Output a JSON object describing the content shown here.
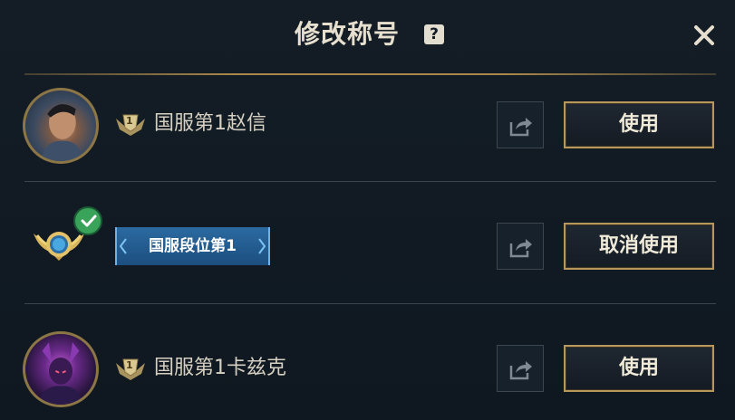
{
  "header": {
    "title": "修改称号",
    "help_glyph": "?"
  },
  "titles": [
    {
      "text": "国服第1赵信",
      "rank_number": "1",
      "action_label": "使用",
      "avatar": "hero-avatar-xin-zhao"
    },
    {
      "text": "国服段位第1",
      "rank_number": "",
      "action_label": "取消使用",
      "avatar": "rank-emblem",
      "selected": true
    },
    {
      "text": "国服第1卡兹克",
      "rank_number": "1",
      "action_label": "使用",
      "avatar": "hero-avatar-khazix"
    }
  ],
  "colors": {
    "accent_gold": "#b8985a",
    "background": "#111a22",
    "banner_blue": "#2b6aa0",
    "check_green": "#3aa35a"
  }
}
